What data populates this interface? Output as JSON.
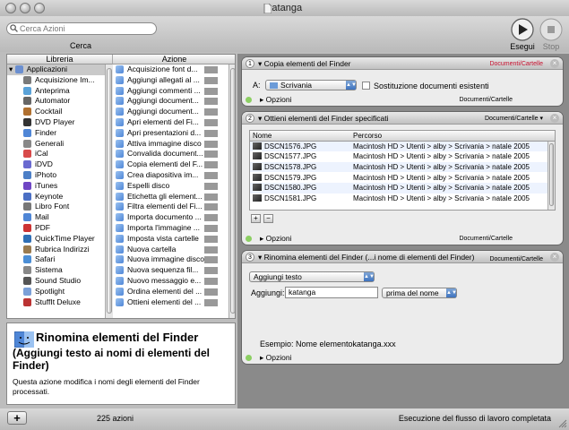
{
  "window": {
    "title": "katanga"
  },
  "toolbar": {
    "search_placeholder": "Cerca Azioni",
    "search_label": "Cerca",
    "run_label": "Esegui",
    "stop_label": "Stop"
  },
  "library": {
    "header_library": "Libreria",
    "header_action": "Azione",
    "apps": [
      "Applicazioni",
      "Acquisizione Im...",
      "Anteprima",
      "Automator",
      "Cocktail",
      "DVD Player",
      "Finder",
      "Generali",
      "iCal",
      "iDVD",
      "iPhoto",
      "iTunes",
      "Keynote",
      "Libro Font",
      "Mail",
      "PDF",
      "QuickTime Player",
      "Rubrica Indirizzi",
      "Safari",
      "Sistema",
      "Sound Studio",
      "Spotlight",
      "StuffIt Deluxe"
    ],
    "actions": [
      "Acquisizione font d...",
      "Aggiungi allegati al ...",
      "Aggiungi commenti ...",
      "Aggiungi document...",
      "Aggiungi document...",
      "Apri elementi del Fi...",
      "Apri presentazioni d...",
      "Attiva immagine disco",
      "Convalida document...",
      "Copia elementi del F...",
      "Crea diapositiva im...",
      "Espelli disco",
      "Etichetta gli element...",
      "Filtra elementi del Fi...",
      "Importa documento ...",
      "Importa l'immagine ...",
      "Imposta vista cartelle",
      "Nuova cartella",
      "Nuova immagine disco",
      "Nuova sequenza fil...",
      "Nuovo messaggio e...",
      "Ordina elementi del ...",
      "Ottieni elementi del ..."
    ]
  },
  "description": {
    "title": "Rinomina elementi del Finder",
    "subtitle": "(Aggiungi testo ai nomi di elementi del Finder)",
    "body": "Questa azione modifica i nomi degli elementi del Finder processati."
  },
  "status": {
    "count": "225 azioni",
    "message": "Esecuzione del flusso di lavoro completata"
  },
  "workflow": {
    "action1": {
      "num": "1",
      "title": "Copia elementi del Finder",
      "type": "Documenti/Cartelle",
      "to_label": "A:",
      "to_value": "Scrivania",
      "replace_label": "Sostituzione documenti esistenti",
      "options": "Opzioni",
      "foot_type": "Documenti/Cartelle"
    },
    "action2": {
      "num": "2",
      "title": "Ottieni elementi del Finder specificati",
      "type": "Documenti/Cartelle",
      "col_name": "Nome",
      "col_path": "Percorso",
      "files": [
        {
          "name": "DSCN1576.JPG",
          "path": "Macintosh HD > Utenti > alby > Scrivania > natale 2005"
        },
        {
          "name": "DSCN1577.JPG",
          "path": "Macintosh HD > Utenti > alby > Scrivania > natale 2005"
        },
        {
          "name": "DSCN1578.JPG",
          "path": "Macintosh HD > Utenti > alby > Scrivania > natale 2005"
        },
        {
          "name": "DSCN1579.JPG",
          "path": "Macintosh HD > Utenti > alby > Scrivania > natale 2005"
        },
        {
          "name": "DSCN1580.JPG",
          "path": "Macintosh HD > Utenti > alby > Scrivania > natale 2005"
        },
        {
          "name": "DSCN1581.JPG",
          "path": "Macintosh HD > Utenti > alby > Scrivania > natale 2005"
        }
      ],
      "add": "+",
      "remove": "−",
      "options": "Opzioni",
      "foot_type": "Documenti/Cartelle"
    },
    "action3": {
      "num": "3",
      "title": "Rinomina elementi del Finder (...i nome di elementi del Finder)",
      "type": "Documenti/Cartelle",
      "mode": "Aggiungi testo",
      "add_label": "Aggiungi:",
      "add_value": "katanga",
      "position": "prima del nome",
      "example": "Esempio: Nome elementokatanga.xxx",
      "options": "Opzioni"
    }
  },
  "colors": {
    "accent": "#3e73bf",
    "ok": "#8ccf63",
    "type_red": "#c8102e"
  }
}
